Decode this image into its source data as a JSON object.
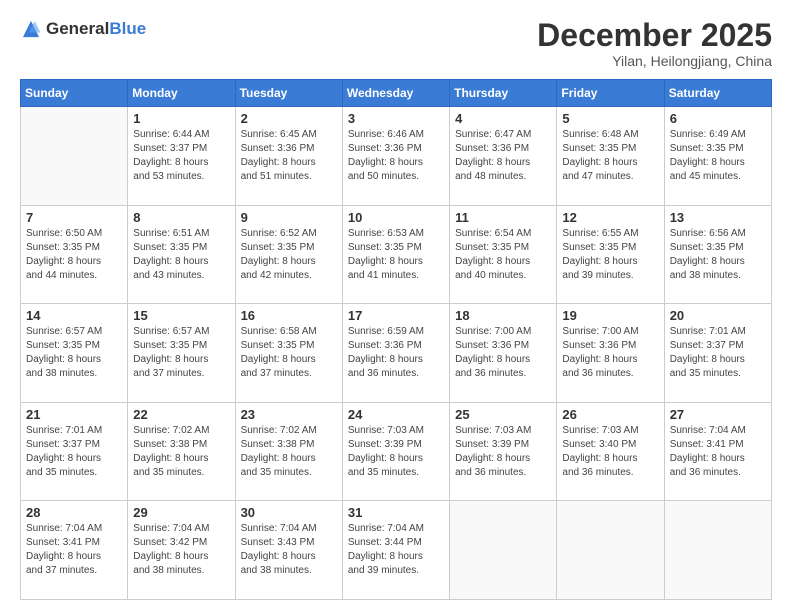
{
  "header": {
    "logo_general": "General",
    "logo_blue": "Blue",
    "month": "December 2025",
    "location": "Yilan, Heilongjiang, China"
  },
  "weekdays": [
    "Sunday",
    "Monday",
    "Tuesday",
    "Wednesday",
    "Thursday",
    "Friday",
    "Saturday"
  ],
  "weeks": [
    [
      {
        "day": "",
        "info": ""
      },
      {
        "day": "1",
        "info": "Sunrise: 6:44 AM\nSunset: 3:37 PM\nDaylight: 8 hours\nand 53 minutes."
      },
      {
        "day": "2",
        "info": "Sunrise: 6:45 AM\nSunset: 3:36 PM\nDaylight: 8 hours\nand 51 minutes."
      },
      {
        "day": "3",
        "info": "Sunrise: 6:46 AM\nSunset: 3:36 PM\nDaylight: 8 hours\nand 50 minutes."
      },
      {
        "day": "4",
        "info": "Sunrise: 6:47 AM\nSunset: 3:36 PM\nDaylight: 8 hours\nand 48 minutes."
      },
      {
        "day": "5",
        "info": "Sunrise: 6:48 AM\nSunset: 3:35 PM\nDaylight: 8 hours\nand 47 minutes."
      },
      {
        "day": "6",
        "info": "Sunrise: 6:49 AM\nSunset: 3:35 PM\nDaylight: 8 hours\nand 45 minutes."
      }
    ],
    [
      {
        "day": "7",
        "info": "Sunrise: 6:50 AM\nSunset: 3:35 PM\nDaylight: 8 hours\nand 44 minutes."
      },
      {
        "day": "8",
        "info": "Sunrise: 6:51 AM\nSunset: 3:35 PM\nDaylight: 8 hours\nand 43 minutes."
      },
      {
        "day": "9",
        "info": "Sunrise: 6:52 AM\nSunset: 3:35 PM\nDaylight: 8 hours\nand 42 minutes."
      },
      {
        "day": "10",
        "info": "Sunrise: 6:53 AM\nSunset: 3:35 PM\nDaylight: 8 hours\nand 41 minutes."
      },
      {
        "day": "11",
        "info": "Sunrise: 6:54 AM\nSunset: 3:35 PM\nDaylight: 8 hours\nand 40 minutes."
      },
      {
        "day": "12",
        "info": "Sunrise: 6:55 AM\nSunset: 3:35 PM\nDaylight: 8 hours\nand 39 minutes."
      },
      {
        "day": "13",
        "info": "Sunrise: 6:56 AM\nSunset: 3:35 PM\nDaylight: 8 hours\nand 38 minutes."
      }
    ],
    [
      {
        "day": "14",
        "info": "Sunrise: 6:57 AM\nSunset: 3:35 PM\nDaylight: 8 hours\nand 38 minutes."
      },
      {
        "day": "15",
        "info": "Sunrise: 6:57 AM\nSunset: 3:35 PM\nDaylight: 8 hours\nand 37 minutes."
      },
      {
        "day": "16",
        "info": "Sunrise: 6:58 AM\nSunset: 3:35 PM\nDaylight: 8 hours\nand 37 minutes."
      },
      {
        "day": "17",
        "info": "Sunrise: 6:59 AM\nSunset: 3:36 PM\nDaylight: 8 hours\nand 36 minutes."
      },
      {
        "day": "18",
        "info": "Sunrise: 7:00 AM\nSunset: 3:36 PM\nDaylight: 8 hours\nand 36 minutes."
      },
      {
        "day": "19",
        "info": "Sunrise: 7:00 AM\nSunset: 3:36 PM\nDaylight: 8 hours\nand 36 minutes."
      },
      {
        "day": "20",
        "info": "Sunrise: 7:01 AM\nSunset: 3:37 PM\nDaylight: 8 hours\nand 35 minutes."
      }
    ],
    [
      {
        "day": "21",
        "info": "Sunrise: 7:01 AM\nSunset: 3:37 PM\nDaylight: 8 hours\nand 35 minutes."
      },
      {
        "day": "22",
        "info": "Sunrise: 7:02 AM\nSunset: 3:38 PM\nDaylight: 8 hours\nand 35 minutes."
      },
      {
        "day": "23",
        "info": "Sunrise: 7:02 AM\nSunset: 3:38 PM\nDaylight: 8 hours\nand 35 minutes."
      },
      {
        "day": "24",
        "info": "Sunrise: 7:03 AM\nSunset: 3:39 PM\nDaylight: 8 hours\nand 35 minutes."
      },
      {
        "day": "25",
        "info": "Sunrise: 7:03 AM\nSunset: 3:39 PM\nDaylight: 8 hours\nand 36 minutes."
      },
      {
        "day": "26",
        "info": "Sunrise: 7:03 AM\nSunset: 3:40 PM\nDaylight: 8 hours\nand 36 minutes."
      },
      {
        "day": "27",
        "info": "Sunrise: 7:04 AM\nSunset: 3:41 PM\nDaylight: 8 hours\nand 36 minutes."
      }
    ],
    [
      {
        "day": "28",
        "info": "Sunrise: 7:04 AM\nSunset: 3:41 PM\nDaylight: 8 hours\nand 37 minutes."
      },
      {
        "day": "29",
        "info": "Sunrise: 7:04 AM\nSunset: 3:42 PM\nDaylight: 8 hours\nand 38 minutes."
      },
      {
        "day": "30",
        "info": "Sunrise: 7:04 AM\nSunset: 3:43 PM\nDaylight: 8 hours\nand 38 minutes."
      },
      {
        "day": "31",
        "info": "Sunrise: 7:04 AM\nSunset: 3:44 PM\nDaylight: 8 hours\nand 39 minutes."
      },
      {
        "day": "",
        "info": ""
      },
      {
        "day": "",
        "info": ""
      },
      {
        "day": "",
        "info": ""
      }
    ]
  ]
}
